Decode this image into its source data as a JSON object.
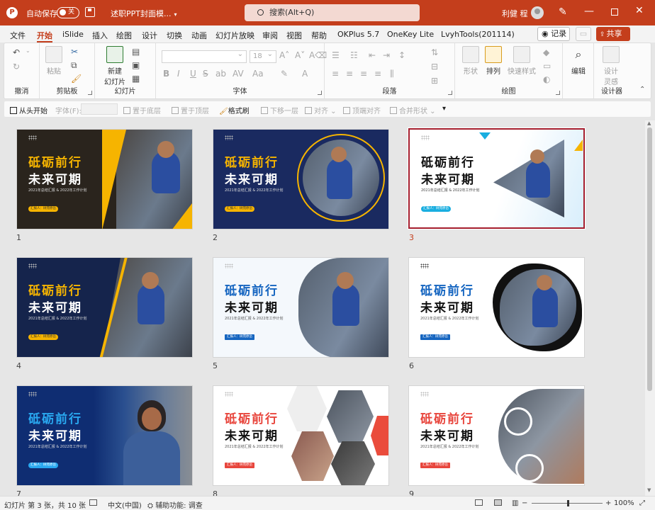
{
  "titlebar": {
    "autosave_label": "自动保存",
    "autosave_state": "关",
    "doc_title": "述职PPT封面模...",
    "search_placeholder": "搜索(Alt+Q)",
    "user_name": "利健 程",
    "accent_color": "#c43e1c"
  },
  "tabs": [
    "文件",
    "开始",
    "iSlide",
    "插入",
    "绘图",
    "设计",
    "切换",
    "动画",
    "幻灯片放映",
    "审阅",
    "视图",
    "帮助",
    "OKPlus 5.7",
    "OneKey Lite",
    "LvyhTools(201114)"
  ],
  "active_tab": "开始",
  "tab_actions": {
    "record": "记录",
    "share": "共享"
  },
  "ribbon": {
    "groups": {
      "undo": "撤消",
      "clipboard": "剪贴板",
      "slides": "幻灯片",
      "font": "字体",
      "paragraph": "段落",
      "drawing": "绘图",
      "designer": "设计器"
    },
    "paste": "粘贴",
    "new_slide": "新建\n幻灯片",
    "font_size": "18",
    "shape": "形状",
    "arrange": "排列",
    "quick_styles": "快速样式",
    "editing": "编辑",
    "design_ideas": "设计\n灵感"
  },
  "qat": {
    "start_from_begin": "从头开始",
    "font_label": "字体(F):",
    "bring_to_bottom": "置于底层",
    "bring_to_top": "置于顶层",
    "format_painter": "格式刷",
    "move_down": "下移一层",
    "align": "对齐",
    "top_align": "顶端对齐",
    "merge_shapes": "合并形状"
  },
  "slides": [
    {
      "num": "1",
      "t1": "砥砺前行",
      "t2": "未来可期",
      "sub": "2021年总结汇报 & 2022年工作计划",
      "pill": "汇报人：树苑原岳",
      "selected": false
    },
    {
      "num": "2",
      "t1": "砥砺前行",
      "t2": "未来可期",
      "sub": "2021年总结汇报 & 2022年工作计划",
      "pill": "汇报人：树苑原岳",
      "selected": false
    },
    {
      "num": "3",
      "t1": "砥砺前行",
      "t2": "未来可期",
      "sub": "2021年总结汇报 & 2022年工作计划",
      "pill": "汇报人：树苑原岳",
      "selected": true
    },
    {
      "num": "4",
      "t1": "砥砺前行",
      "t2": "未来可期",
      "sub": "2021年总结汇报 & 2022年工作计划",
      "pill": "汇报人：树苑原岳",
      "selected": false
    },
    {
      "num": "5",
      "t1": "砥砺前行",
      "t2": "未来可期",
      "sub": "2021年总结汇报 & 2022年工作计划",
      "pill": "汇报人：树苑原岳",
      "selected": false
    },
    {
      "num": "6",
      "t1": "砥砺前行",
      "t2": "未来可期",
      "sub": "2021年总结汇报 & 2022年工作计划",
      "pill": "汇报人：树苑原岳",
      "selected": false
    },
    {
      "num": "7",
      "t1": "砥砺前行",
      "t2": "未来可期",
      "sub": "2021年总结汇报 & 2022年工作计划",
      "pill": "汇报人：树苑原岳",
      "selected": false
    },
    {
      "num": "8",
      "t1": "砥砺前行",
      "t2": "未来可期",
      "sub": "2021年总结汇报 & 2022年工作计划",
      "pill": "汇报人：树苑原岳",
      "selected": false
    },
    {
      "num": "9",
      "t1": "砥砺前行",
      "t2": "未来可期",
      "sub": "2021年总结汇报 & 2022年工作计划",
      "pill": "汇报人：树苑原岳",
      "selected": false
    }
  ],
  "statusbar": {
    "slide_info": "幻灯片 第 3 张，共 10 张",
    "language": "中文(中国)",
    "accessibility": "辅助功能: 调查",
    "zoom": "100%"
  }
}
